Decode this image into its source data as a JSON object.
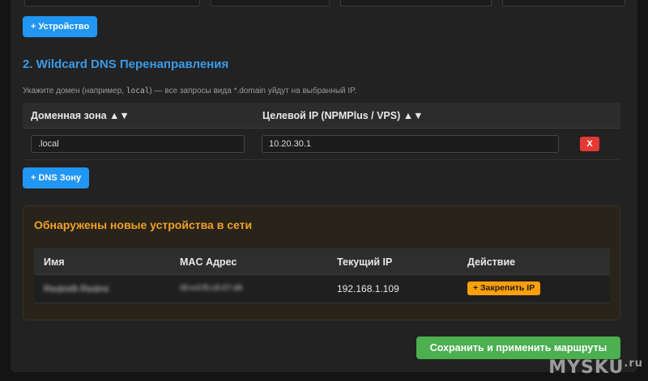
{
  "add_device_button": "+ Устройство",
  "wildcard": {
    "title": "2. Wildcard DNS Перенаправления",
    "desc_before": "Укажите домен (например, ",
    "desc_code": "local",
    "desc_after": ") — все запросы вида *.domain уйдут на выбранный IP.",
    "columns": [
      "Доменная зона ▲▼",
      "Целевой IP (NPMPlus / VPS) ▲▼"
    ],
    "rows": [
      {
        "zone": ".local",
        "ip": "10.20.30.1",
        "delete_label": "X"
      }
    ],
    "add_zone_button": "+ DNS Зону"
  },
  "discovered": {
    "title": "Обнаружены новые устройства в сети",
    "columns": [
      "Имя",
      "MAC Адрес",
      "Текущий IP",
      "Действие"
    ],
    "rows": [
      {
        "name": "Redmi9-Redmi",
        "mac": "00:e3:f5:c6:07:d6",
        "ip": "192.168.1.109",
        "action": "+ Закрепить IP"
      }
    ]
  },
  "save_button": "Сохранить и применить маршруты",
  "watermark": {
    "main": "MYSKU",
    "suffix": ".ru"
  },
  "colors": {
    "accent_blue": "#2196f3",
    "section_title": "#3a9be8",
    "warning_title": "#f0a02a",
    "delete_red": "#e53935",
    "pin_orange": "#ff9f0a",
    "save_green": "#4caf50"
  }
}
